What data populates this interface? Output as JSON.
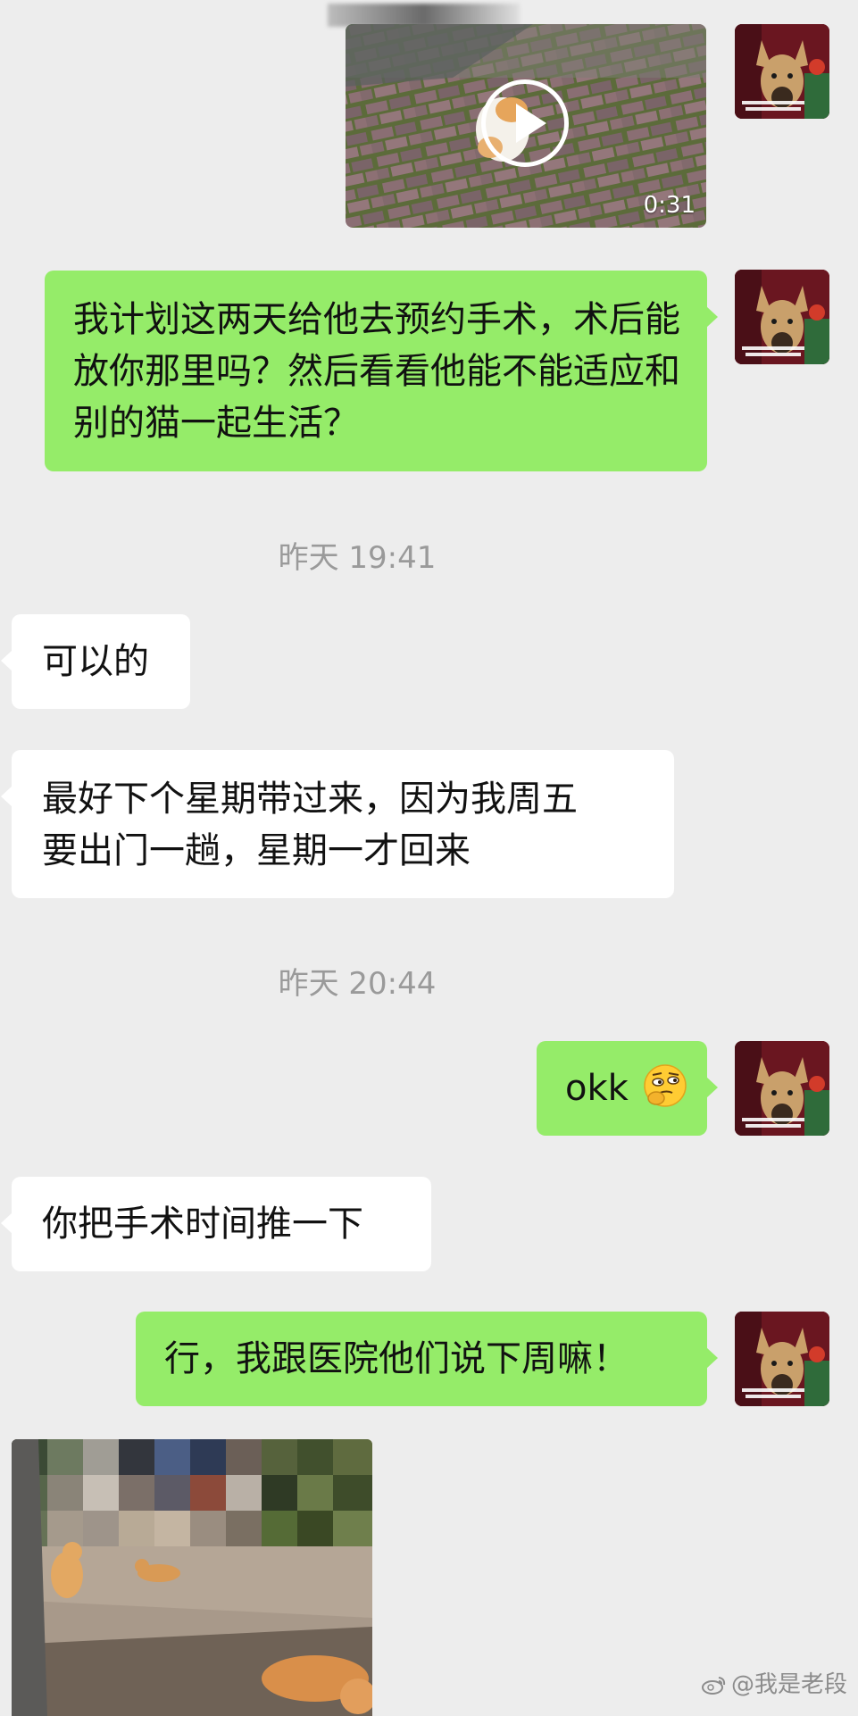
{
  "messages": {
    "video_duration": "0:31",
    "msg1": "我计划这两天给他去预约手术，术后能放你那里吗？然后看看他能不能适应和别的猫一起生活？",
    "time1": "昨天 19:41",
    "msg2": "可以的",
    "msg3_line1": "最好下个星期带过来，因为我周五",
    "msg3_line2": "要出门一趟，星期一才回来",
    "time2": "昨天 20:44",
    "msg4": "okk",
    "msg5": "你把手术时间推一下",
    "msg6": "行，我跟医院他们说下周嘛！"
  },
  "watermark": "@我是老段",
  "colors": {
    "my_bubble": "#95ec69",
    "other_bubble": "#ffffff",
    "background": "#ededed"
  },
  "icons": {
    "emoji": "thinking-face-emoji",
    "play": "play-icon"
  }
}
